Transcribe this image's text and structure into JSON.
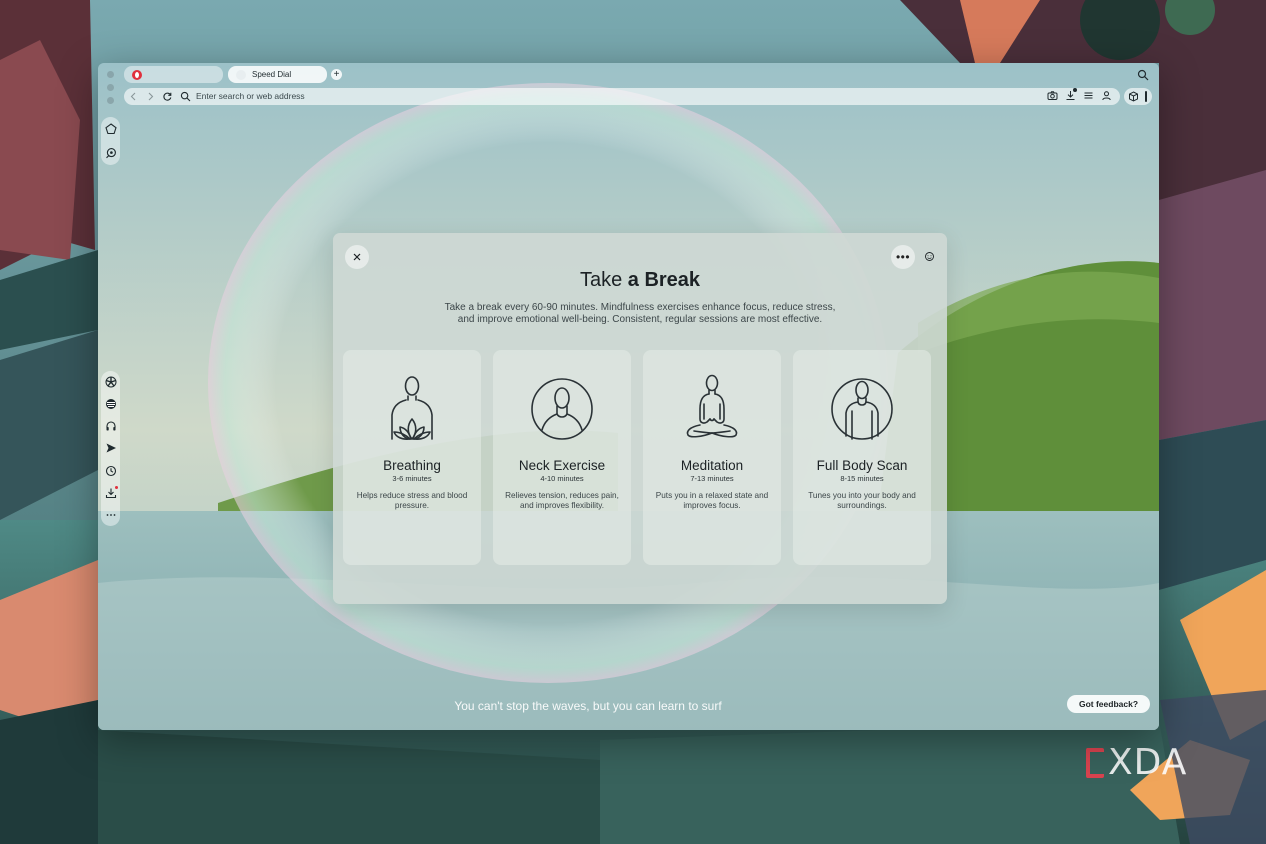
{
  "browser": {
    "tabs": [
      {
        "label": ""
      },
      {
        "label": "Speed Dial"
      }
    ],
    "address_placeholder": "Enter search or web address"
  },
  "dialog": {
    "title_prefix": "Take",
    "title_emphasis": "a Break",
    "more_label": "•••",
    "description": "Take a break every 60-90 minutes. Mindfulness exercises enhance focus, reduce stress, and improve emotional well-being. Consistent, regular sessions are most effective.",
    "cards": [
      {
        "title": "Breathing",
        "duration": "3-6 minutes",
        "description": "Helps reduce stress and blood pressure."
      },
      {
        "title": "Neck Exercise",
        "duration": "4-10 minutes",
        "description": "Relieves tension, reduces pain, and improves flexibility."
      },
      {
        "title": "Meditation",
        "duration": "7-13 minutes",
        "description": "Puts you in a relaxed state and improves focus."
      },
      {
        "title": "Full Body Scan",
        "duration": "8-15 minutes",
        "description": "Tunes you into your body and surroundings."
      }
    ]
  },
  "footer": {
    "quote": "You can't stop the waves, but you can learn to surf",
    "feedback_label": "Got feedback?"
  },
  "watermark": {
    "text": "XDA"
  },
  "colors": {
    "accent_red": "#e0303d",
    "dialog_bg": "#ced8d4"
  }
}
